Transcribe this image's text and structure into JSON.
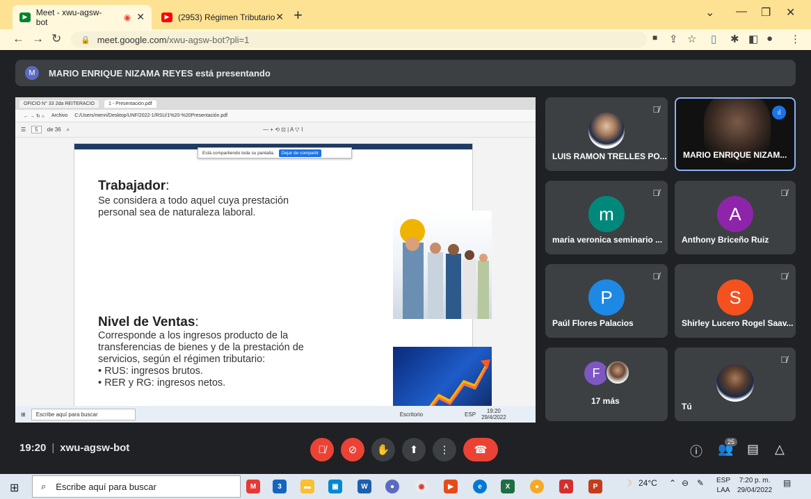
{
  "browser": {
    "tabs": [
      {
        "label": "Meet - xwu-agsw-bot",
        "active": true
      },
      {
        "label": "(2953) Régimen Tributario Sunat",
        "active": false
      }
    ],
    "url_domain": "meet.google.com",
    "url_path": "/xwu-agsw-bot?pli=1"
  },
  "meet": {
    "presenting_avatar": "M",
    "presenting_text": "MARIO ENRIQUE NIZAMA REYES está presentando",
    "time": "19:20",
    "meeting_code": "xwu-agsw-bot",
    "participant_count": "25"
  },
  "shared_screen": {
    "inner_tabs": [
      "OFICIO N° 33 2da REITERACIO",
      "1 - Presentación.pdf"
    ],
    "inner_url": "C:/Users/menri/Desktop/UNF/2022-1/RSU/1%20-%20Presentación.pdf",
    "inner_url_prefix": "Archivo",
    "page_current": "5",
    "page_total": "de 36",
    "share_notice": "Está compartiendo toda su pantalla.",
    "stop_share": "Dejar de compartir",
    "slide": {
      "heading1": "Trabajador",
      "heading1_suffix": ":",
      "body1": [
        "Se considera a todo aquel cuya prestación",
        "personal sea de naturaleza laboral."
      ],
      "heading2": "Nivel de Ventas",
      "heading2_suffix": ":",
      "body2": [
        "Corresponde a los ingresos producto de la",
        "transferencias de bienes y de la prestación de",
        "servicios, según el régimen tributario:"
      ],
      "bullets": [
        "RUS: ingresos brutos.",
        "RER y RG: ingresos netos."
      ]
    },
    "inner_taskbar": {
      "search": "Escribe aquí para buscar",
      "desk": "Escritorio",
      "lang": "ESP",
      "time": "19:20",
      "date": "29/4/2022"
    }
  },
  "participants": [
    {
      "name": "LUIS RAMON TRELLES PO...",
      "type": "photo"
    },
    {
      "name": "MARIO ENRIQUE NIZAM...",
      "type": "video"
    },
    {
      "name": "maria veronica seminario ...",
      "initial": "m",
      "color": "#00897b"
    },
    {
      "name": "Anthony Briceño Ruiz",
      "initial": "A",
      "color": "#8e24aa"
    },
    {
      "name": "Paúl Flores Palacios",
      "initial": "P",
      "color": "#1e88e5"
    },
    {
      "name": "Shirley Lucero Rogel Saav...",
      "initial": "S",
      "color": "#f4511e"
    },
    {
      "name": "17 más",
      "initial": "F",
      "color": "#7e57c2"
    },
    {
      "name": "Tú",
      "type": "photo"
    }
  ],
  "taskbar": {
    "search": "Escribe aquí para buscar",
    "temp": "24°C",
    "lang1": "ESP",
    "lang2": "LAA",
    "time": "7:20 p. m.",
    "date": "29/04/2022",
    "mail_badge": "3"
  }
}
